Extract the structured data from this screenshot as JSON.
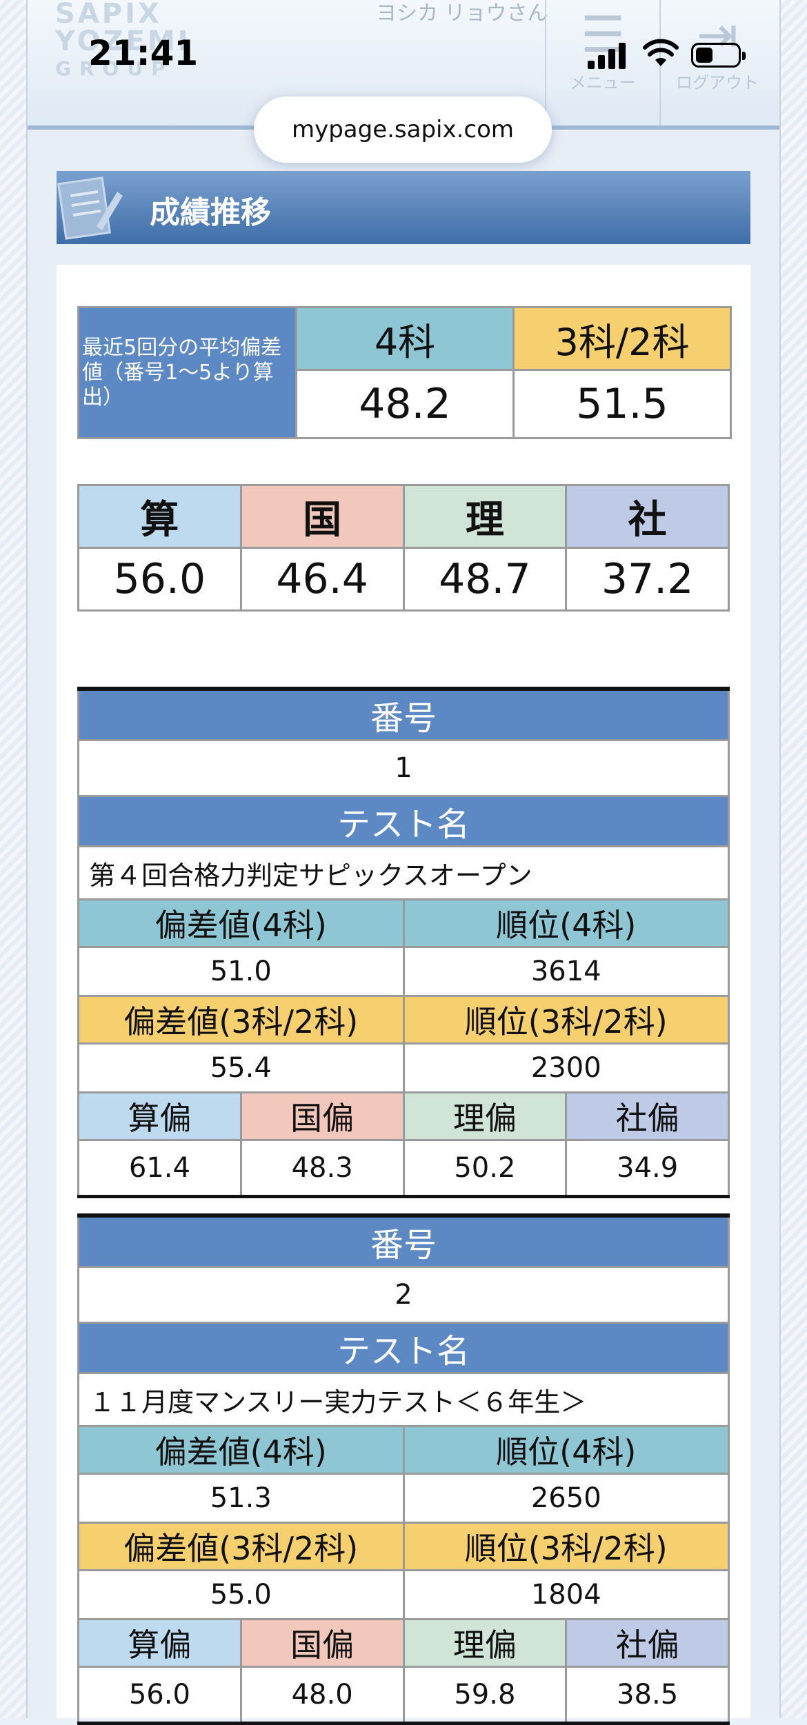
{
  "status_bar": {
    "time": "21:41"
  },
  "site_header": {
    "logo_lines": [
      "SAPIX",
      "YOZEMI",
      "GROUP"
    ],
    "user_name": "ヨシカ リョウさん",
    "menu_label": "メニュー",
    "logout_label": "ログアウト"
  },
  "browser": {
    "url": "mypage.sapix.com"
  },
  "section": {
    "title": "成績推移"
  },
  "average": {
    "label": "最近5回分の平均偏差値（番号1〜5より算出）",
    "four_label": "4科",
    "three_label": "3科/2科",
    "four_value": "48.2",
    "three_value": "51.5"
  },
  "subjects": [
    {
      "name": "算",
      "value": "56.0"
    },
    {
      "name": "国",
      "value": "46.4"
    },
    {
      "name": "理",
      "value": "48.7"
    },
    {
      "name": "社",
      "value": "37.2"
    }
  ],
  "labels": {
    "number": "番号",
    "test_name": "テスト名",
    "dev4": "偏差値(4科)",
    "rank4": "順位(4科)",
    "dev3": "偏差値(3科/2科)",
    "rank3": "順位(3科/2科)",
    "math_dev": "算偏",
    "jp_dev": "国偏",
    "sci_dev": "理偏",
    "soc_dev": "社偏"
  },
  "tests": [
    {
      "number": "1",
      "name": "第４回合格力判定サピックスオープン",
      "dev4": "51.0",
      "rank4": "3614",
      "dev3": "55.4",
      "rank3": "2300",
      "math": "61.4",
      "jp": "48.3",
      "sci": "50.2",
      "soc": "34.9"
    },
    {
      "number": "2",
      "name": "１１月度マンスリー実力テスト＜６年生＞",
      "dev4": "51.3",
      "rank4": "2650",
      "dev3": "55.0",
      "rank3": "1804",
      "math": "56.0",
      "jp": "48.0",
      "sci": "59.8",
      "soc": "38.5"
    }
  ]
}
